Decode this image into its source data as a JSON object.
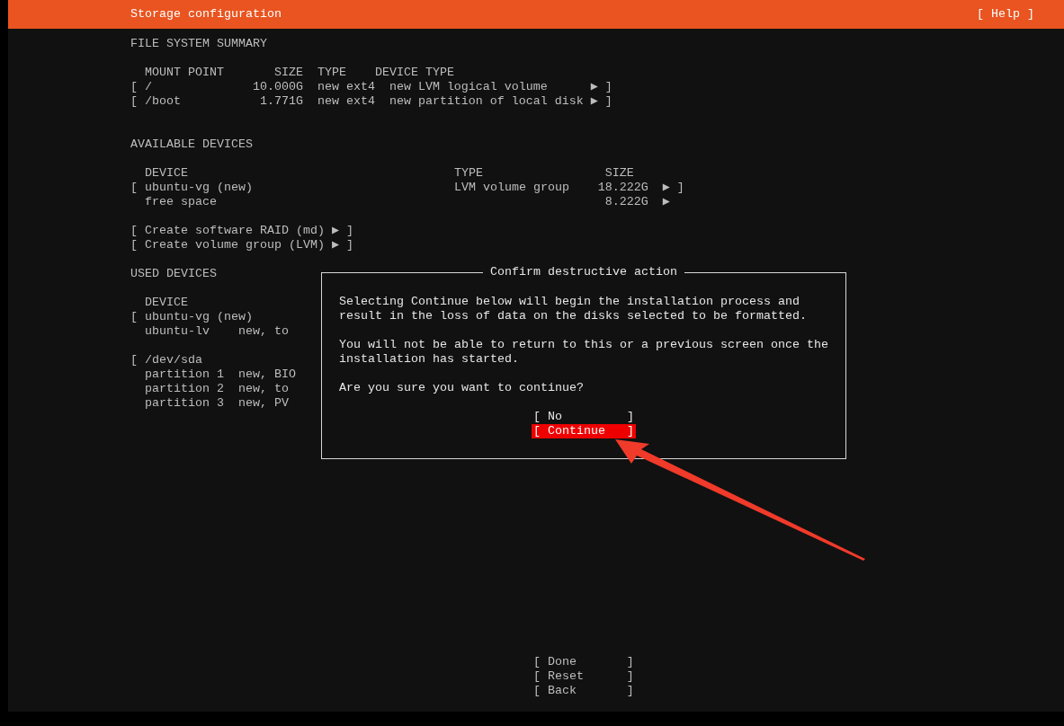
{
  "header": {
    "title": "Storage configuration",
    "help": "[ Help ]"
  },
  "file_system_summary": {
    "heading": "FILE SYSTEM SUMMARY",
    "columns": [
      "MOUNT POINT",
      "SIZE",
      "TYPE",
      "DEVICE TYPE"
    ],
    "rows": [
      {
        "open": "[",
        "mount_point": "/",
        "size": "10.000G",
        "type": "new ext4",
        "device_type": "new LVM logical volume",
        "arrow": "▶",
        "close": "]"
      },
      {
        "open": "[",
        "mount_point": "/boot",
        "size": "1.771G",
        "type": "new ext4",
        "device_type": "new partition of local disk",
        "arrow": "▶",
        "close": "]"
      }
    ]
  },
  "available_devices": {
    "heading": "AVAILABLE DEVICES",
    "columns": [
      "DEVICE",
      "TYPE",
      "SIZE"
    ],
    "rows": [
      {
        "open": "[",
        "device": "ubuntu-vg (new)",
        "type": "LVM volume group",
        "size": "18.222G",
        "arrow": "▶",
        "close": "]"
      },
      {
        "device": "free space",
        "size": "8.222G",
        "arrow": "▶"
      }
    ],
    "actions": [
      "[ Create software RAID (md) ▶ ]",
      "[ Create volume group (LVM) ▶ ]"
    ]
  },
  "used_devices": {
    "heading": "USED DEVICES",
    "columns": [
      "DEVICE"
    ],
    "rows": [
      {
        "open": "[",
        "device": "ubuntu-vg (new)",
        "children": [
          {
            "device": "ubuntu-lv",
            "detail": "new, to"
          }
        ]
      },
      {
        "open": "[",
        "device": "/dev/sda",
        "children": [
          {
            "device": "partition 1",
            "detail": "new, BIO"
          },
          {
            "device": "partition 2",
            "detail": "new, to"
          },
          {
            "device": "partition 3",
            "detail": "new, PV"
          }
        ]
      }
    ]
  },
  "dialog": {
    "title": "Confirm destructive action",
    "paragraphs": [
      "Selecting Continue below will begin the installation process and result in the loss of data on the disks selected to be formatted.",
      "You will not be able to return to this or a previous screen once the installation has started.",
      "Are you sure you want to continue?"
    ],
    "buttons": [
      {
        "label": "[ No         ]",
        "selected": false
      },
      {
        "label": "[ Continue   ]",
        "selected": true
      }
    ]
  },
  "footer_buttons": [
    "[ Done       ]",
    "[ Reset      ]",
    "[ Back       ]"
  ]
}
